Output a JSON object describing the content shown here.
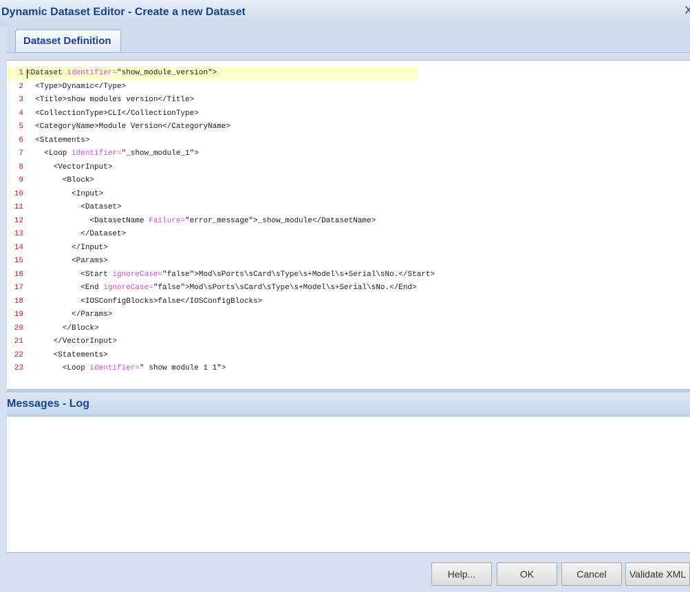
{
  "window": {
    "title": "Dynamic Dataset Editor - Create a new Dataset",
    "close_glyph": "X"
  },
  "tabs": [
    {
      "label": "Dataset Definition",
      "active": true
    }
  ],
  "editor": {
    "lines": [
      {
        "n": "1",
        "parts": [
          [
            "t",
            "<Dataset "
          ],
          [
            "a",
            "identifier="
          ],
          [
            "t",
            "\"show_module_version\">"
          ]
        ]
      },
      {
        "n": "2",
        "parts": [
          [
            "t",
            "  <Type>Dynamic</Type>"
          ]
        ]
      },
      {
        "n": "3",
        "parts": [
          [
            "t",
            "  <Title>show modules version</Title>"
          ]
        ]
      },
      {
        "n": "4",
        "parts": [
          [
            "t",
            "  <CollectionType>CLI</CollectionType>"
          ]
        ]
      },
      {
        "n": "5",
        "parts": [
          [
            "t",
            "  <CategoryName>Module Version</CategoryName>"
          ]
        ]
      },
      {
        "n": "6",
        "parts": [
          [
            "t",
            "  <Statements>"
          ]
        ]
      },
      {
        "n": "7",
        "parts": [
          [
            "t",
            "    <Loop "
          ],
          [
            "a",
            "identifier="
          ],
          [
            "t",
            "\"_show_module_1\">"
          ]
        ]
      },
      {
        "n": "8",
        "parts": [
          [
            "t",
            "      <VectorInput>"
          ]
        ]
      },
      {
        "n": "9",
        "parts": [
          [
            "t",
            "        <Block>"
          ]
        ]
      },
      {
        "n": "10",
        "parts": [
          [
            "t",
            "          <Input>"
          ]
        ]
      },
      {
        "n": "11",
        "parts": [
          [
            "t",
            "            <Dataset>"
          ]
        ]
      },
      {
        "n": "12",
        "parts": [
          [
            "t",
            "              <DatasetName "
          ],
          [
            "a",
            "Failure="
          ],
          [
            "t",
            "\"error_message\">_show_module</DatasetName>"
          ]
        ]
      },
      {
        "n": "13",
        "parts": [
          [
            "t",
            "            </Dataset>"
          ]
        ]
      },
      {
        "n": "14",
        "parts": [
          [
            "t",
            "          </Input>"
          ]
        ]
      },
      {
        "n": "15",
        "parts": [
          [
            "t",
            "          <Params>"
          ]
        ]
      },
      {
        "n": "16",
        "parts": [
          [
            "t",
            "            <Start "
          ],
          [
            "a",
            "ignoreCase="
          ],
          [
            "t",
            "\"false\">Mod\\sPorts\\sCard\\sType\\s+Model\\s+Serial\\sNo.</Start>"
          ]
        ]
      },
      {
        "n": "17",
        "parts": [
          [
            "t",
            "            <End "
          ],
          [
            "a",
            "ignoreCase="
          ],
          [
            "t",
            "\"false\">Mod\\sPorts\\sCard\\sType\\s+Model\\s+Serial\\sNo.</End>"
          ]
        ]
      },
      {
        "n": "18",
        "parts": [
          [
            "t",
            "            <IOSConfigBlocks>false</IOSConfigBlocks>"
          ]
        ]
      },
      {
        "n": "19",
        "parts": [
          [
            "t",
            "          </Params>"
          ]
        ]
      },
      {
        "n": "20",
        "parts": [
          [
            "t",
            "        </Block>"
          ]
        ]
      },
      {
        "n": "21",
        "parts": [
          [
            "t",
            "      </VectorInput>"
          ]
        ]
      },
      {
        "n": "22",
        "parts": [
          [
            "t",
            "      <Statements>"
          ]
        ]
      },
      {
        "n": "23",
        "parts": [
          [
            "t",
            "        <Loop "
          ],
          [
            "a",
            "identifier="
          ],
          [
            "t",
            "\" show module 1 1\">"
          ]
        ]
      }
    ],
    "active_line": "1",
    "attr_color": "#d44ad4",
    "line_number_color": "#aa2222"
  },
  "log": {
    "title": "Messages - Log"
  },
  "footer": {
    "help_label": "Help...",
    "ok_label": "OK",
    "cancel_label": "Cancel",
    "validate_label": "Validate XML"
  },
  "colors": {
    "title_text": "#15428b",
    "panel_bg": "#d5e0ef",
    "active_line_bg": "#ffffcc"
  }
}
